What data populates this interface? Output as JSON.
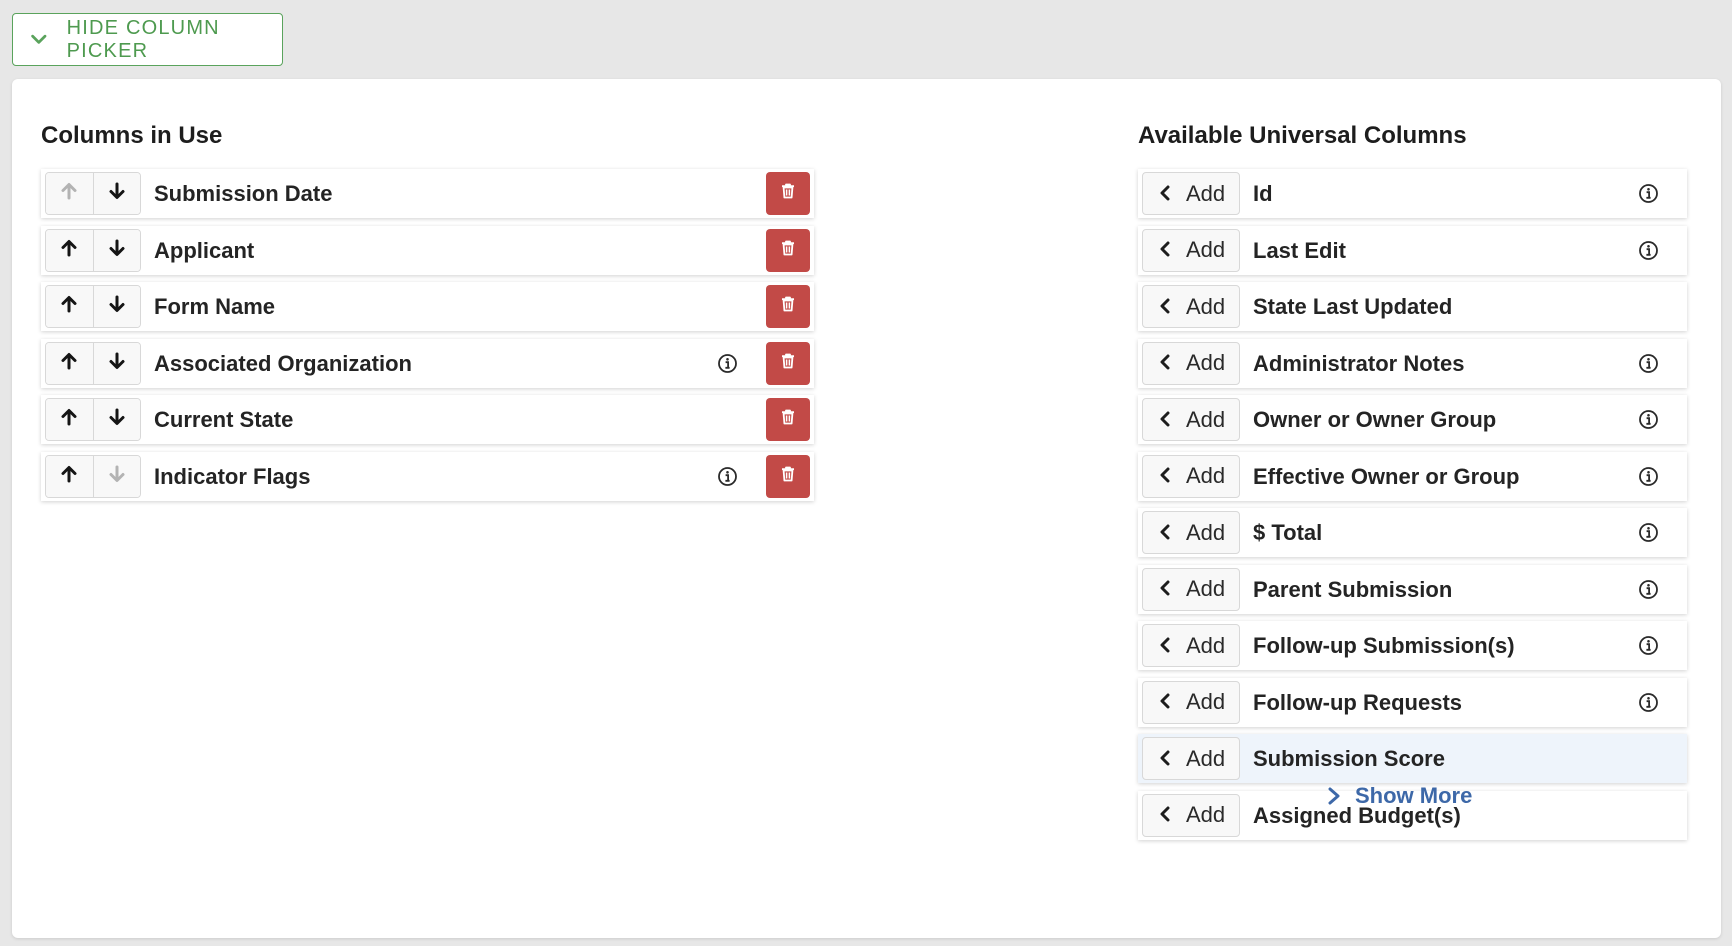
{
  "toggle": {
    "label": "HIDE COLUMN PICKER"
  },
  "in_use": {
    "title": "Columns in Use",
    "items": [
      {
        "label": "Submission Date",
        "info": false,
        "up_enabled": false,
        "down_enabled": true
      },
      {
        "label": "Applicant",
        "info": false,
        "up_enabled": true,
        "down_enabled": true
      },
      {
        "label": "Form Name",
        "info": false,
        "up_enabled": true,
        "down_enabled": true
      },
      {
        "label": "Associated Organization",
        "info": true,
        "up_enabled": true,
        "down_enabled": true
      },
      {
        "label": "Current State",
        "info": false,
        "up_enabled": true,
        "down_enabled": true
      },
      {
        "label": "Indicator Flags",
        "info": true,
        "up_enabled": true,
        "down_enabled": false
      }
    ]
  },
  "available": {
    "title": "Available Universal Columns",
    "add_label": "Add",
    "items": [
      {
        "label": "Id",
        "info": true,
        "highlight": false
      },
      {
        "label": "Last Edit",
        "info": true,
        "highlight": false
      },
      {
        "label": "State Last Updated",
        "info": false,
        "highlight": false
      },
      {
        "label": "Administrator Notes",
        "info": true,
        "highlight": false
      },
      {
        "label": "Owner or Owner Group",
        "info": true,
        "highlight": false
      },
      {
        "label": "Effective Owner or Group",
        "info": true,
        "highlight": false
      },
      {
        "label": "$ Total",
        "info": true,
        "highlight": false
      },
      {
        "label": "Parent Submission",
        "info": true,
        "highlight": false
      },
      {
        "label": "Follow-up Submission(s)",
        "info": true,
        "highlight": false
      },
      {
        "label": "Follow-up Requests",
        "info": true,
        "highlight": false
      },
      {
        "label": "Submission Score",
        "info": false,
        "highlight": true
      },
      {
        "label": "Assigned Budget(s)",
        "info": false,
        "highlight": false
      }
    ],
    "show_more": "Show More"
  },
  "colors": {
    "accent_green": "#4e9a4f",
    "delete_red": "#c24a47",
    "link_blue": "#3d68a8",
    "row_highlight": "#eef4fb"
  },
  "icons": {
    "toggle": "chevron-down-icon",
    "move_up": "arrow-up-icon",
    "move_down": "arrow-down-icon",
    "delete": "trash-icon",
    "info": "info-icon",
    "add": "chevron-left-icon",
    "show_more": "chevron-right-icon"
  }
}
